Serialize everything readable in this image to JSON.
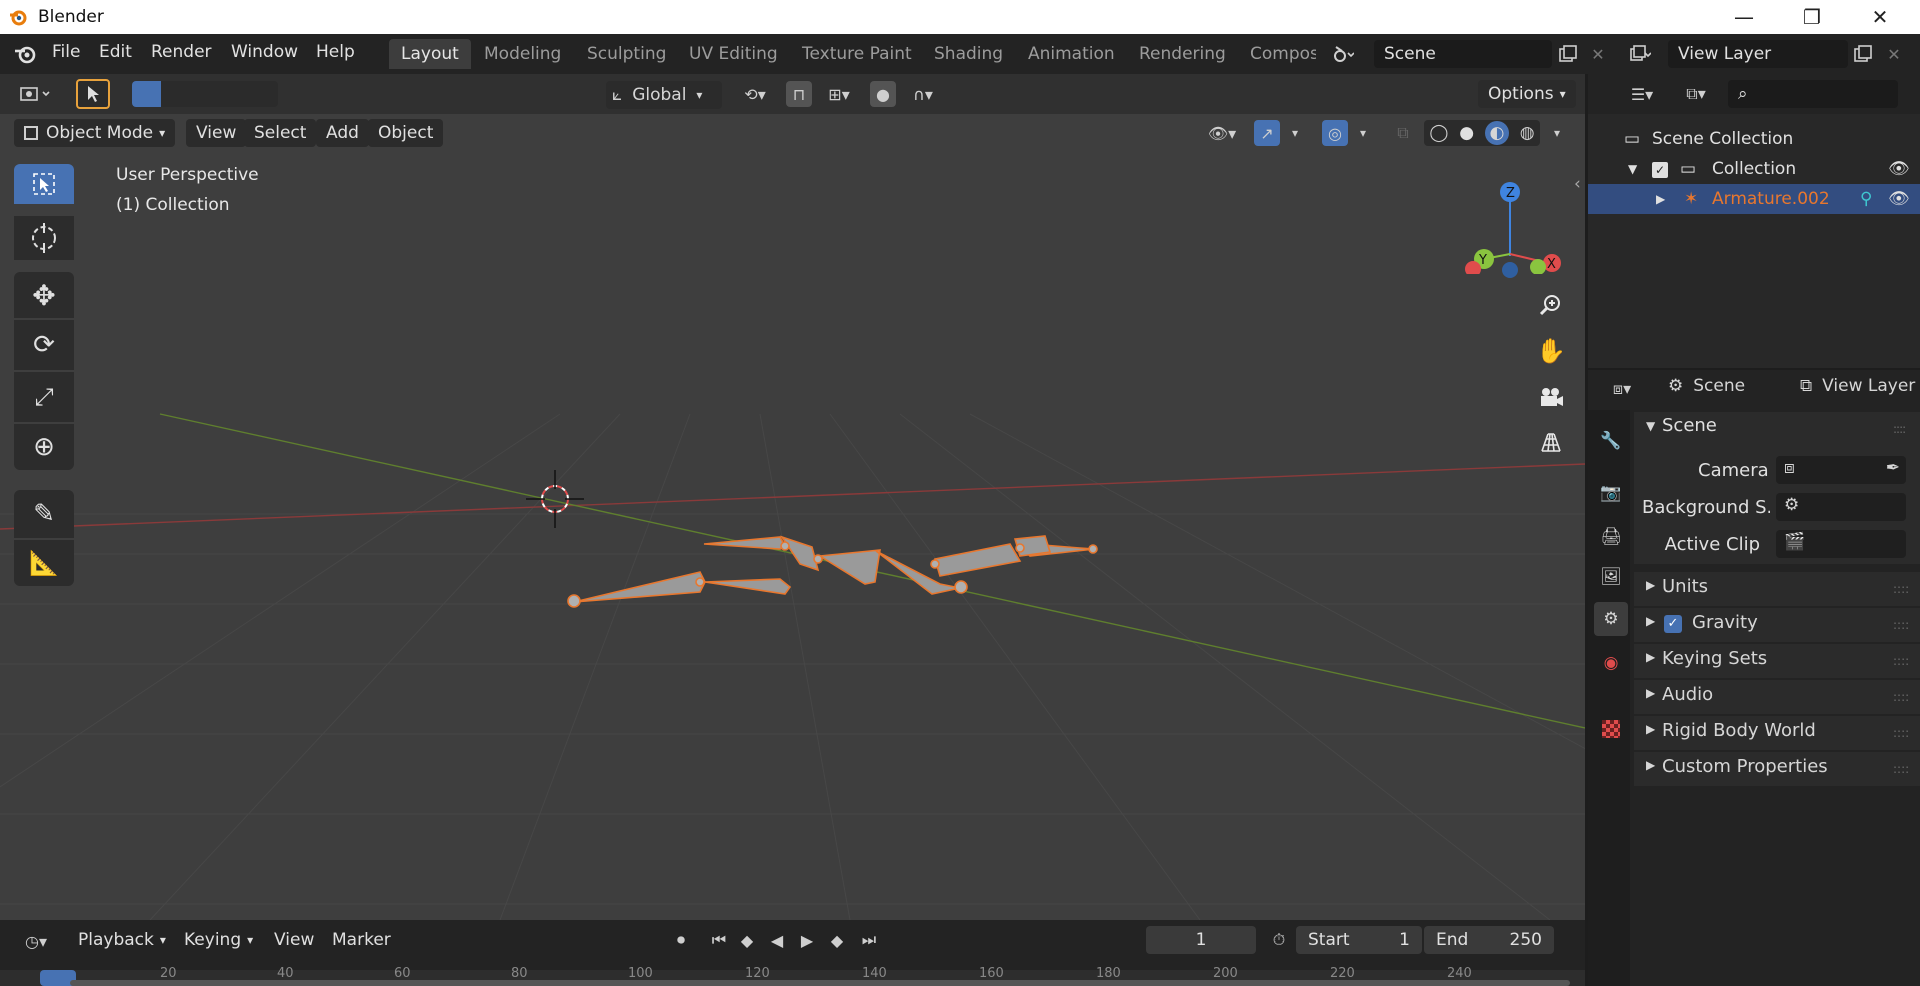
{
  "window": {
    "title": "Blender",
    "minimize": "—",
    "restore": "❐",
    "close": "✕"
  },
  "menus": [
    "File",
    "Edit",
    "Render",
    "Window",
    "Help"
  ],
  "workspaces": [
    "Layout",
    "Modeling",
    "Sculpting",
    "UV Editing",
    "Texture Paint",
    "Shading",
    "Animation",
    "Rendering",
    "Compos"
  ],
  "active_workspace": "Layout",
  "scene_field": "Scene",
  "view_layer_field": "View Layer",
  "tool_header": {
    "orientation": "Global",
    "options": "Options"
  },
  "viewport_header": {
    "mode": "Object Mode",
    "menus": [
      "View",
      "Select",
      "Add",
      "Object"
    ]
  },
  "overlay_text": {
    "line1": "User Perspective",
    "line2": "(1) Collection"
  },
  "gizmo": {
    "z": "Z",
    "y": "Y",
    "x": "X"
  },
  "outliner": {
    "scene_collection": "Scene Collection",
    "collection": "Collection",
    "armature": "Armature.002"
  },
  "properties": {
    "tabs_header": {
      "scene": "Scene",
      "view_layer": "View Layer"
    },
    "panel_title": "Scene",
    "fields": [
      {
        "label": "Camera"
      },
      {
        "label": "Background S..."
      },
      {
        "label": "Active Clip"
      }
    ],
    "panels": [
      "Units",
      "Gravity",
      "Keying Sets",
      "Audio",
      "Rigid Body World",
      "Custom Properties"
    ],
    "gravity_checked": true
  },
  "timeline": {
    "menus": [
      "Playback",
      "Keying",
      "View",
      "Marker"
    ],
    "current_frame": "1",
    "start_label": "Start",
    "start_value": "1",
    "end_label": "End",
    "end_value": "250",
    "ruler": [
      "20",
      "40",
      "60",
      "80",
      "100",
      "120",
      "140",
      "160",
      "180",
      "200",
      "220",
      "240"
    ]
  },
  "colors": {
    "accent": "#4772b3",
    "selected_orange": "#e8772e",
    "x_axis": "#e04c4c",
    "y_axis": "#8ac43f",
    "z_axis": "#3f84e0"
  }
}
